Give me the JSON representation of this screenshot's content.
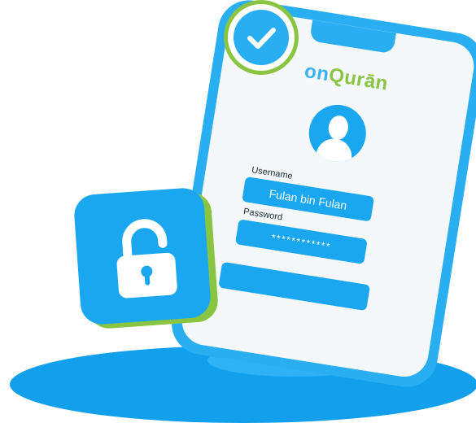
{
  "brand": {
    "name_part1": "on",
    "name_part2": "Qurān"
  },
  "login_form": {
    "username_label": "Username",
    "username_value": "Fulan bin Fulan",
    "password_label": "Password",
    "password_value": "************",
    "login_button_label": ""
  },
  "icons": {
    "badge": "checkmark-icon",
    "tile": "padlock-unlocked-icon",
    "avatar": "user-avatar-icon"
  },
  "colors": {
    "primary_blue": "#1ba7ef",
    "accent_green": "#8ac541",
    "ground_blue": "#12a0ec",
    "screen_white": "#f4f8fb"
  }
}
